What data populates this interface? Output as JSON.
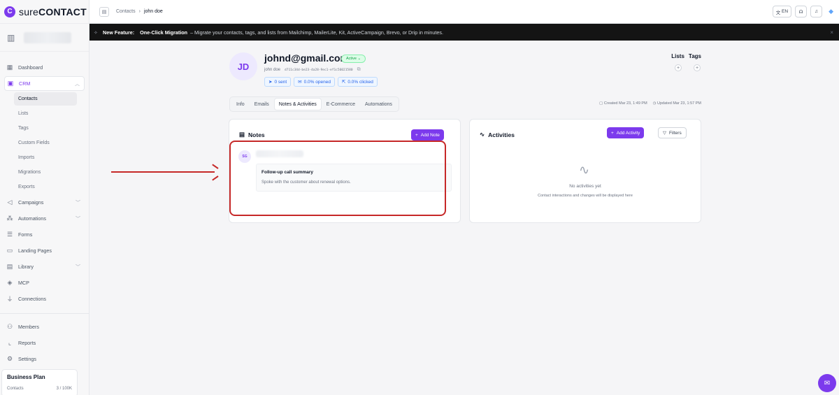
{
  "brand": {
    "logo_letter": "C",
    "name_light": "sure",
    "name_bold": "CONTACT"
  },
  "sidebar": {
    "items": [
      {
        "label": "Dashboard",
        "icon": "grid-icon"
      },
      {
        "label": "CRM",
        "icon": "crm-icon"
      },
      {
        "label": "Campaigns",
        "icon": "megaphone-icon"
      },
      {
        "label": "Automations",
        "icon": "flow-icon"
      },
      {
        "label": "Forms",
        "icon": "form-icon"
      },
      {
        "label": "Landing Pages",
        "icon": "page-icon"
      },
      {
        "label": "Library",
        "icon": "library-icon"
      },
      {
        "label": "MCP",
        "icon": "mcp-icon"
      },
      {
        "label": "Connections",
        "icon": "plug-icon"
      },
      {
        "label": "Members",
        "icon": "users-icon"
      },
      {
        "label": "Reports",
        "icon": "chart-icon"
      },
      {
        "label": "Settings",
        "icon": "gear-icon"
      }
    ],
    "crm_sub": [
      "Contacts",
      "Lists",
      "Tags",
      "Custom Fields",
      "Imports",
      "Migrations",
      "Exports"
    ],
    "plan": {
      "title": "Business Plan",
      "label": "Contacts",
      "value": "3 / 100K"
    }
  },
  "header": {
    "breadcrumb": [
      "Contacts",
      "john doe"
    ],
    "lang": "EN"
  },
  "banner": {
    "prefix": "New Feature:",
    "feature": "One-Click Migration",
    "text": "– Migrate your contacts, tags, and lists from Mailchimp, MailerLite, Kit, ActiveCampaign, Brevo, or Drip in minutes."
  },
  "contact": {
    "initials": "JD",
    "email": "johnd@gmail.com",
    "status": "Active",
    "name": "john doe",
    "uid": "d711c34d-be23-4a28-9ec1-ef1c56021580",
    "stats": {
      "sent": "0 sent",
      "opened": "0.0% opened",
      "clicked": "0.0% clicked"
    },
    "lists_label": "Lists",
    "tags_label": "Tags",
    "created": "Created Mar 23, 1:49 PM",
    "updated": "Updated Mar 23, 1:57 PM"
  },
  "tabs": [
    "Info",
    "Emails",
    "Notes & Activities",
    "E-Commerce",
    "Automations"
  ],
  "active_tab": "Notes & Activities",
  "notes": {
    "title": "Notes",
    "add_label": "Add Note",
    "items": [
      {
        "avatar": "SG",
        "title": "Follow-up call summary",
        "body": "Spoke with the customer about renewal options."
      }
    ]
  },
  "activities": {
    "title": "Activities",
    "add_label": "Add Activity",
    "filter_label": "Filters",
    "empty_title": "No activities yet",
    "empty_sub": "Contact interactions and changes will be displayed here"
  },
  "colors": {
    "accent": "#7c3aed",
    "annotation": "#c62828",
    "banner_bg": "#141414"
  }
}
